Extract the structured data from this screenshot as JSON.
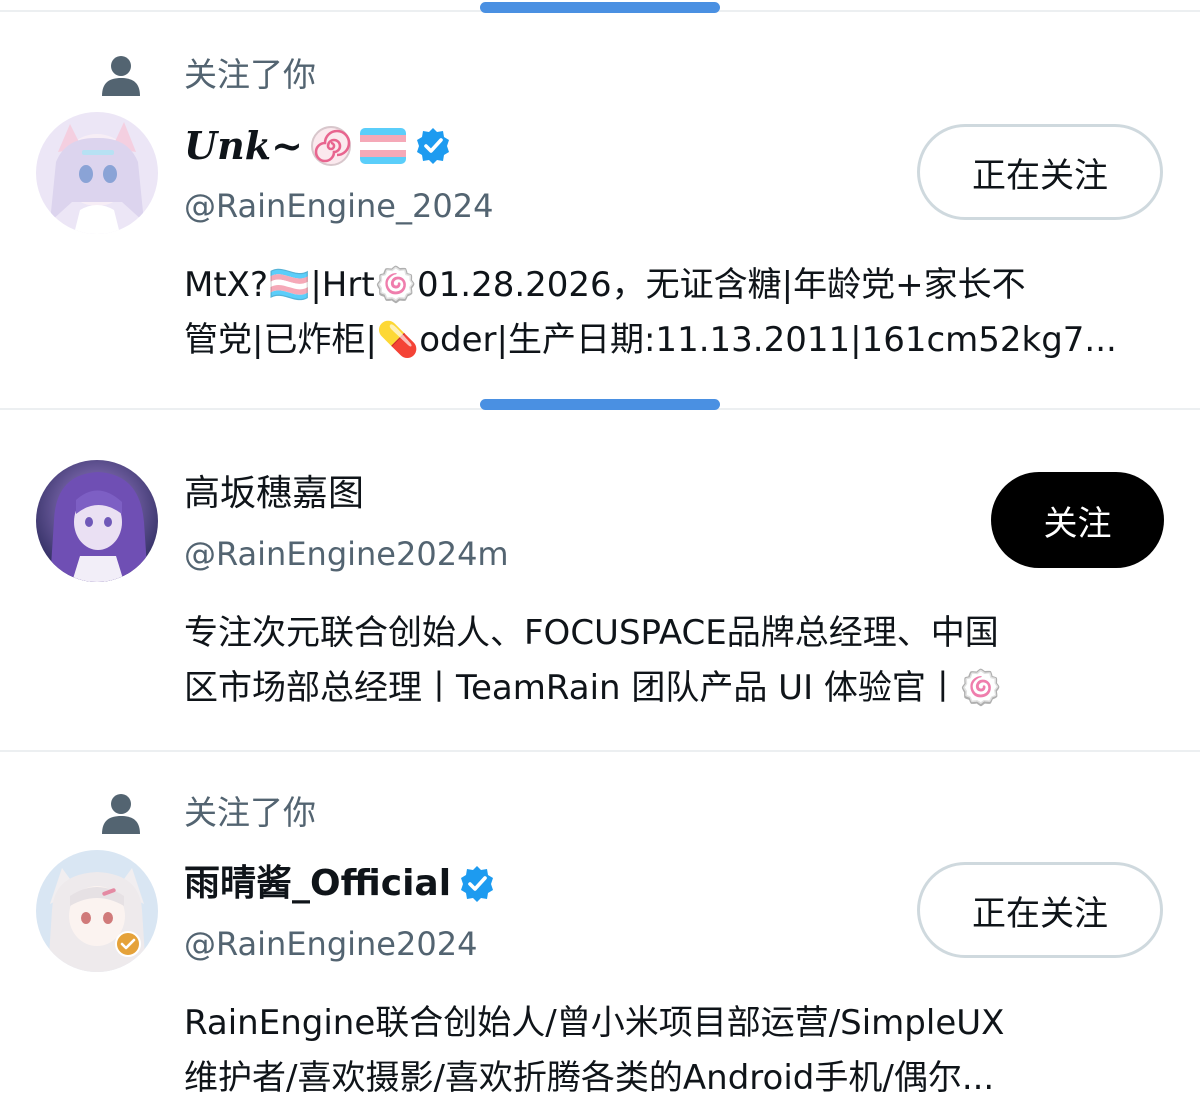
{
  "colors": {
    "accent": "#4a90e2",
    "verified": "#1d9bf0",
    "text_primary": "#0f1419",
    "text_secondary": "#536471",
    "button_outline_border": "#cfd9de"
  },
  "users": [
    {
      "follows_you_label": "关注了你",
      "display_name": "Unk~",
      "name_emojis": [
        "swirl-lollipop-emoji",
        "trans-flag-emoji"
      ],
      "verified": true,
      "handle": "@RainEngine_2024",
      "bio_lines": [
        "MtX?🏳️‍⚧️|Hrt🍥01.28.2026，无证含糖|年龄党+家长不",
        "管党|已炸柜|💊oder|生产日期:11.13.2011|161cm52kg7..."
      ],
      "button_label": "正在关注",
      "button_style": "outline"
    },
    {
      "follows_you_label": "",
      "display_name": "高坂穗嘉图",
      "verified": false,
      "handle": "@RainEngine2024m",
      "bio_lines": [
        "专注次元联合创始人、FOCUSPACE品牌总经理、中国",
        "区市场部总经理丨TeamRain 团队产品 UI 体验官丨🍥"
      ],
      "button_label": "关注",
      "button_style": "solid"
    },
    {
      "follows_you_label": "关注了你",
      "display_name": "雨晴酱_Official",
      "verified": true,
      "handle": "@RainEngine2024",
      "bio_lines": [
        "RainEngine联合创始人/曾小米项目部运营/SimpleUX",
        "维护者/喜欢摄影/喜欢折腾各类的Android手机/偶尔..."
      ],
      "button_label": "正在关注",
      "button_style": "outline"
    }
  ]
}
